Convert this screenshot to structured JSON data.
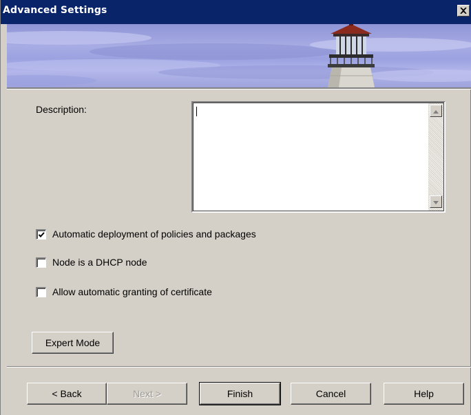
{
  "window": {
    "title": "Advanced Settings"
  },
  "form": {
    "description_label": "Description:",
    "description_value": "",
    "checkboxes": [
      {
        "label": "Automatic deployment of policies and packages",
        "checked": true
      },
      {
        "label": "Node is a DHCP node",
        "checked": false
      },
      {
        "label": "Allow automatic granting of certificate",
        "checked": false
      }
    ],
    "expert_mode_label": "Expert Mode"
  },
  "buttons": {
    "back": "< Back",
    "next": "Next >",
    "finish": "Finish",
    "cancel": "Cancel",
    "help": "Help"
  },
  "icons": {
    "close": "close-icon",
    "scroll_up": "scroll-up-arrow-icon",
    "scroll_down": "scroll-down-arrow-icon",
    "check": "checkmark-icon"
  },
  "colors": {
    "titlebar": "#0a246a",
    "dialog_face": "#d4d0c8",
    "banner_sky": "#a7ace4"
  }
}
